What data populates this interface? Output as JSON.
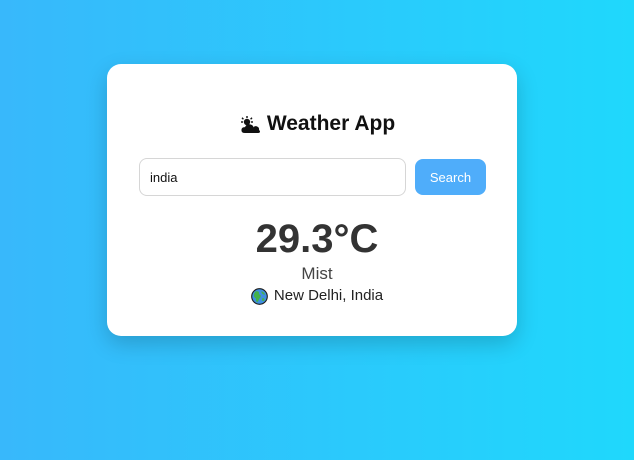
{
  "app": {
    "title": "Weather App",
    "title_icon": "sun-behind-cloud-icon"
  },
  "search": {
    "value": "india",
    "placeholder": "",
    "button_label": "Search"
  },
  "weather": {
    "temperature": "29.3°C",
    "condition": "Mist",
    "location": "New Delhi, India",
    "location_icon": "globe-icon"
  },
  "colors": {
    "background_start": "#38b8fb",
    "background_end": "#1fd8fc",
    "button": "#4fadfa",
    "card": "#ffffff"
  }
}
